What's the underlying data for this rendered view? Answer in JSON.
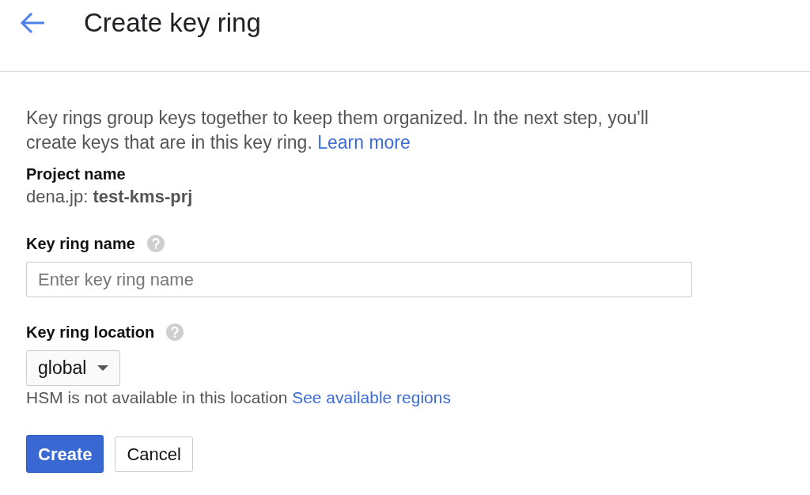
{
  "header": {
    "title": "Create key ring"
  },
  "description": {
    "text": "Key rings group keys together to keep them organized. In the next step, you'll create keys that are in this key ring.",
    "link": "Learn more"
  },
  "project": {
    "label": "Project name",
    "value": "dena.jp: **test-kms-prj**"
  },
  "fields": [
    {
      "kind": "text",
      "label": "Key ring name",
      "placeholder": "Enter key ring name"
    },
    {
      "kind": "select",
      "label": "Key ring location",
      "value": "global",
      "hint": "HSM is not available in this location",
      "hint_link": "See available regions"
    }
  ],
  "buttons": [
    {
      "kind": "primary",
      "label": "Create"
    },
    {
      "kind": "secondary",
      "label": "Cancel"
    }
  ]
}
